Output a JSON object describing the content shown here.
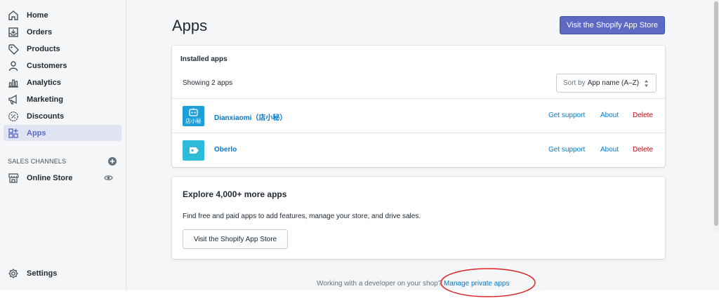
{
  "sidebar": {
    "items": [
      {
        "label": "Home",
        "icon": "home-icon"
      },
      {
        "label": "Orders",
        "icon": "orders-icon"
      },
      {
        "label": "Products",
        "icon": "tag-icon"
      },
      {
        "label": "Customers",
        "icon": "person-icon"
      },
      {
        "label": "Analytics",
        "icon": "bar-chart-icon"
      },
      {
        "label": "Marketing",
        "icon": "megaphone-icon"
      },
      {
        "label": "Discounts",
        "icon": "discount-icon"
      },
      {
        "label": "Apps",
        "icon": "apps-icon",
        "active": true
      }
    ],
    "channels_title": "SALES CHANNELS",
    "online_store": "Online Store",
    "settings": "Settings"
  },
  "page": {
    "title": "Apps",
    "primary_button": "Visit the Shopify App Store"
  },
  "installed": {
    "title": "Installed apps",
    "showing": "Showing 2 apps",
    "sort_label": "Sort by",
    "sort_value": "App name (A–Z)",
    "apps": [
      {
        "name": "Dianxiaomi（店小秘）",
        "logo_text": "店小秘",
        "logo_color": "#1e9fd8",
        "support": "Get support",
        "about": "About",
        "delete": "Delete"
      },
      {
        "name": "Oberlo",
        "logo_color": "#2bbbd8",
        "support": "Get support",
        "about": "About",
        "delete": "Delete"
      }
    ]
  },
  "explore": {
    "title": "Explore 4,000+ more apps",
    "description": "Find free and paid apps to add features, manage your store, and drive sales.",
    "button": "Visit the Shopify App Store"
  },
  "footer": {
    "text": "Working with a developer on your shop?",
    "link": "Manage private apps"
  },
  "colors": {
    "accent": "#5c6ac4",
    "link": "#007ace",
    "danger": "#bf0711",
    "annotation": "#e02020"
  }
}
